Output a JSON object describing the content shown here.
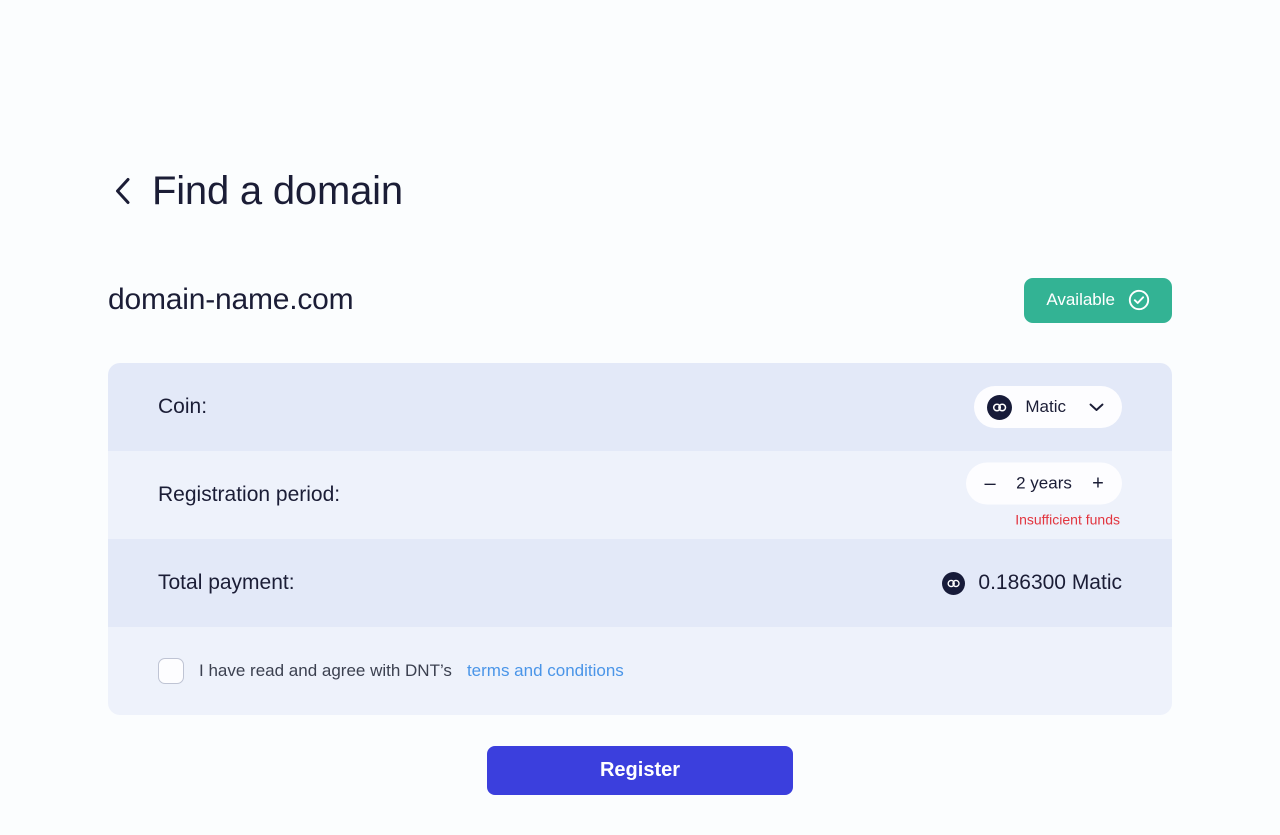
{
  "header": {
    "back_icon": "chevron-left-icon",
    "title": "Find a domain"
  },
  "domain": {
    "name": "domain-name.com",
    "status_label": "Available",
    "status_icon": "check-circle-icon",
    "status_color": "#33b394"
  },
  "form": {
    "coin": {
      "label": "Coin:",
      "selected": "Matic",
      "icon": "matic-coin-icon",
      "chevron_icon": "chevron-down-icon"
    },
    "period": {
      "label": "Registration period:",
      "decrement_label": "–",
      "value": "2 years",
      "increment_label": "+",
      "error": "Insufficient funds"
    },
    "total": {
      "label": "Total payment:",
      "icon": "matic-coin-icon",
      "amount": "0.186300 Matic"
    },
    "terms": {
      "checked": false,
      "text": "I have read and agree with DNT’s",
      "link_label": "terms and conditions",
      "link_color": "#4a95e8"
    }
  },
  "actions": {
    "register_label": "Register",
    "register_color": "#3b3fdd"
  }
}
